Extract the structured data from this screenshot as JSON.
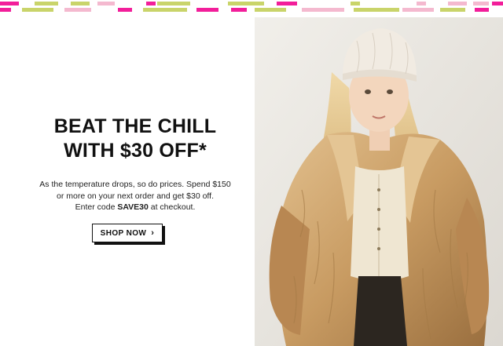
{
  "promo": {
    "headline": [
      "BEAT THE CHILL",
      "WITH $30 OFF*"
    ],
    "body_lines": [
      "As the temperature drops, so do prices. Spend $150",
      "or more on your next order and get $30 off."
    ],
    "code_line": {
      "before": "Enter code ",
      "code": "SAVE30",
      "after": " at checkout."
    },
    "cta_label": "SHOP NOW",
    "cta_icon": "chevron-right-icon"
  },
  "colors": {
    "accent_pink": "#f21e9a",
    "accent_lime": "#c9d46a",
    "accent_light_pink": "#f4b9cf",
    "text": "#111111"
  }
}
